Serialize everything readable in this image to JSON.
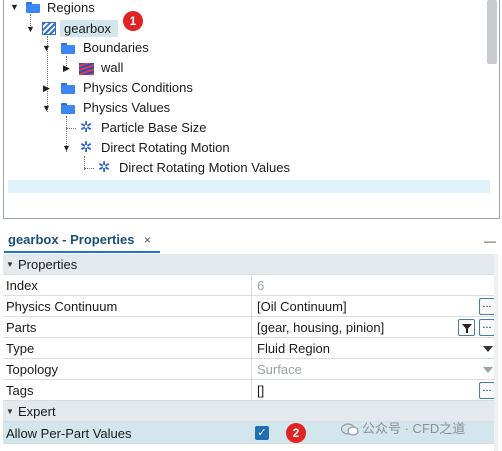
{
  "tree": {
    "items": [
      {
        "label": "Regions"
      },
      {
        "label": "gearbox"
      },
      {
        "label": "Boundaries"
      },
      {
        "label": "wall"
      },
      {
        "label": "Physics Conditions"
      },
      {
        "label": "Physics Values"
      },
      {
        "label": "Particle Base Size"
      },
      {
        "label": "Direct Rotating Motion"
      },
      {
        "label": "Direct Rotating Motion Values"
      }
    ],
    "badge_1": "1"
  },
  "properties_tab": {
    "title": "gearbox - Properties",
    "close_glyph": "×",
    "minimize_glyph": "—"
  },
  "properties": {
    "section_properties": "Properties",
    "section_expert": "Expert",
    "rows": [
      {
        "key": "Index",
        "value": "6"
      },
      {
        "key": "Physics Continuum",
        "value": "[Oil Continuum]"
      },
      {
        "key": "Parts",
        "value": "[gear, housing, pinion]"
      },
      {
        "key": "Type",
        "value": "Fluid Region"
      },
      {
        "key": "Topology",
        "value": "Surface"
      },
      {
        "key": "Tags",
        "value": "[]"
      }
    ],
    "expert_rows": [
      {
        "key": "Allow Per-Part Values",
        "checked": true
      }
    ],
    "badge_2": "2",
    "ellipsis": "..."
  },
  "watermark": "公众号 · CFD之道",
  "colors": {
    "accent": "#1e77c8",
    "badge": "#e02424",
    "selection": "#d3e6ee",
    "section_header": "#e4e9ee"
  }
}
